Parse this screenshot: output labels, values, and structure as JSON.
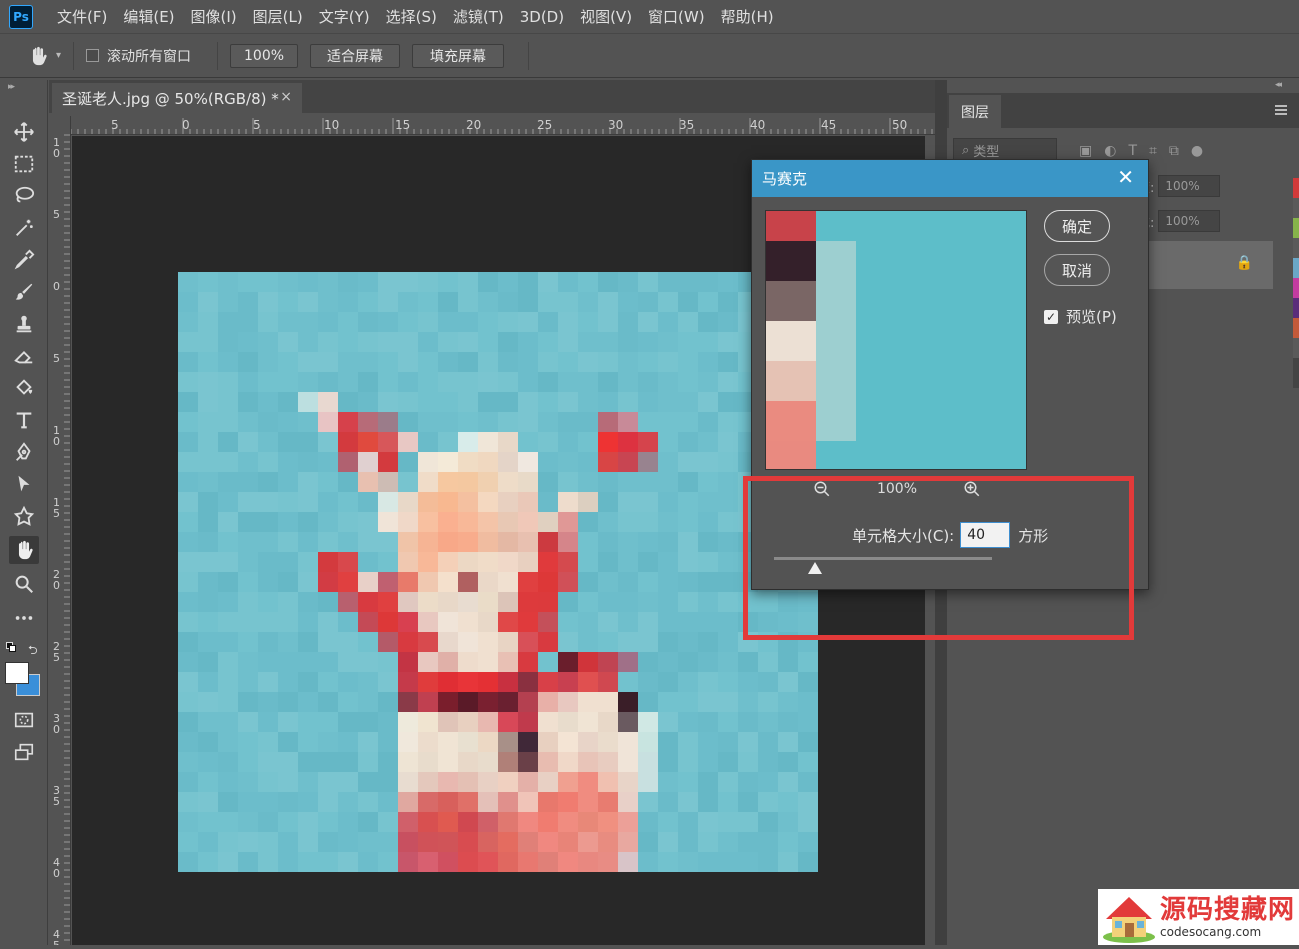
{
  "app": {
    "logo_text": "Ps",
    "menu": [
      "文件(F)",
      "编辑(E)",
      "图像(I)",
      "图层(L)",
      "文字(Y)",
      "选择(S)",
      "滤镜(T)",
      "3D(D)",
      "视图(V)",
      "窗口(W)",
      "帮助(H)"
    ]
  },
  "options_bar": {
    "scroll_all_label": "滚动所有窗口",
    "scroll_all_checked": false,
    "zoom_value": "100%",
    "fit_screen_label": "适合屏幕",
    "fill_screen_label": "填充屏幕"
  },
  "document": {
    "tab_title": "圣诞老人.jpg @ 50%(RGB/8) *",
    "close_glyph": "×",
    "ruler_h_labels": [
      "5",
      "0",
      "5",
      "10",
      "15",
      "20",
      "25",
      "30",
      "35",
      "40",
      "45",
      "50"
    ],
    "ruler_v_labels": [
      "1\n0",
      "5",
      "0",
      "5",
      "1\n0",
      "1\n5",
      "2\n0",
      "2\n5",
      "3\n0",
      "3\n5",
      "4\n0",
      "4\n5"
    ]
  },
  "tools": [
    "move-tool",
    "marquee-tool",
    "lasso-tool",
    "magic-wand-tool",
    "eyedropper-tool",
    "brush-tool",
    "stamp-tool",
    "eraser-tool",
    "paint-bucket-tool",
    "type-tool",
    "pen-tool",
    "path-select-tool",
    "shape-tool",
    "hand-tool",
    "zoom-tool",
    "more-tools"
  ],
  "colors": {
    "foreground": "#ffffff",
    "background": "#3a8fd9",
    "accent": "#3a96c7",
    "highlight": "#e23a3a"
  },
  "layers_panel": {
    "tab_label": "图层",
    "filter_placeholder": "类型",
    "opacity_label": "度:",
    "opacity_value": "100%",
    "fill_label": "充:",
    "fill_value": "100%"
  },
  "mosaic_dialog": {
    "title": "马赛克",
    "ok_label": "确定",
    "cancel_label": "取消",
    "preview_label": "预览(P)",
    "preview_checked": true,
    "zoom_level": "100%",
    "cell_size_label": "单元格大小(C):",
    "cell_size_value": "40",
    "cell_unit": "方形",
    "slider_value": 40
  },
  "watermark": {
    "title": "源码搜藏网",
    "url": "codesocang.com"
  }
}
